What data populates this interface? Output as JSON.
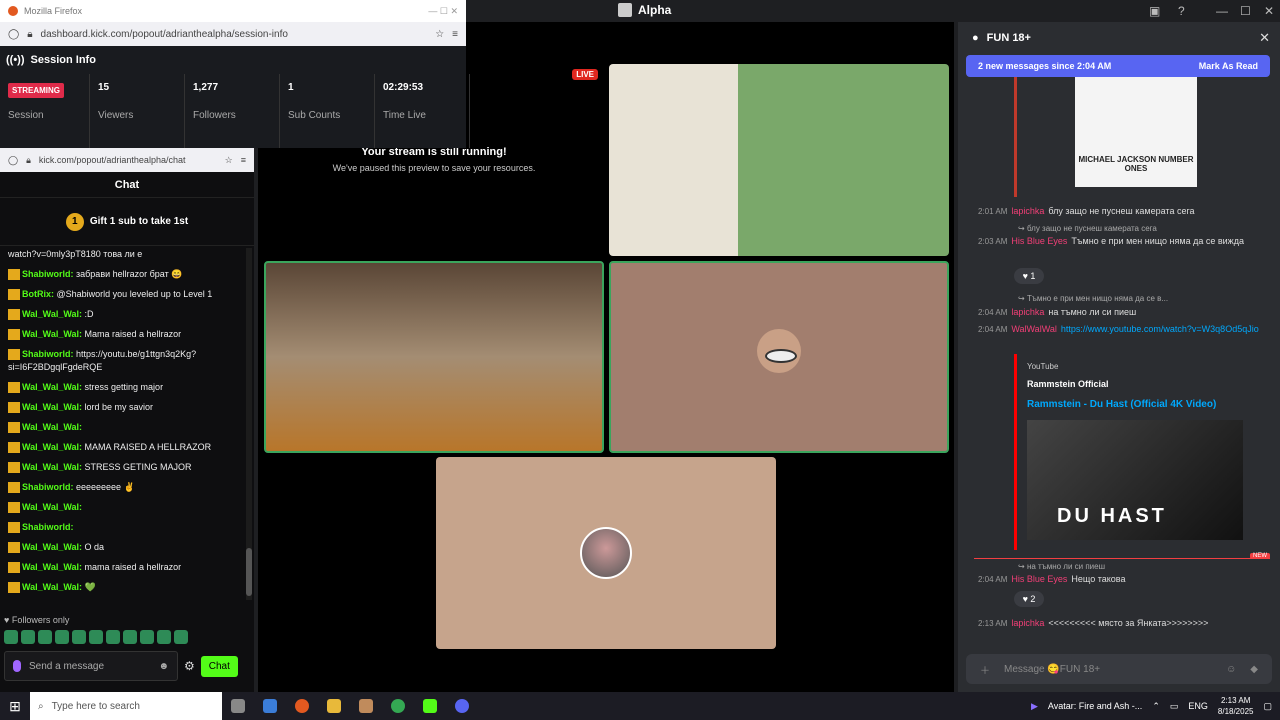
{
  "discord": {
    "window_title": "Alpha",
    "channel": "FUN 18+",
    "new_messages": "2 new messages since 2:04 AM",
    "mark_as_read": "Mark As Read",
    "embed1_text": "MICHAEL JACKSON NUMBER ONES",
    "messages": [
      {
        "time": "2:01 AM",
        "user": "lapichka",
        "text": "блу защо не пуснеш камерата сега"
      },
      {
        "reply": "блу защо не пуснеш камерата сега",
        "time": "2:03 AM",
        "user": "His Blue Eyes",
        "text": "Тъмно е при мен нищо няма да се вижда"
      },
      {
        "reply": "Тъмно е при мен нищо няма да се в...",
        "time": "2:04 AM",
        "user": "lapichka",
        "text": "на тъмно ли си пиеш"
      },
      {
        "time": "2:04 AM",
        "user": "WalWalWal",
        "link": "https://www.youtube.com/watch?v=W3q8Od5qJio"
      },
      {
        "reply": "на тъмно ли си пиеш",
        "time": "2:04 AM",
        "user": "His Blue Eyes",
        "text": "Нещо такова"
      },
      {
        "time": "2:13 AM",
        "user": "lapichka",
        "text": "<<<<<<<<< място за Янката>>>>>>>>"
      }
    ],
    "react1": "1",
    "react2": "2",
    "yt": {
      "source": "YouTube",
      "author": "Rammstein Official",
      "title": "Rammstein - Du Hast (Official 4K Video)",
      "thumb": "DU HAST"
    },
    "new_label": "NEW",
    "input_placeholder": "Message 😋FUN 18+"
  },
  "stage": {
    "live": "LIVE",
    "paused_title": "Your stream is still running!",
    "paused_sub": "We've paused this preview to save your resources."
  },
  "session": {
    "window_title": "Mozilla Firefox",
    "url_domain": "dashboard.kick.com",
    "url_path": "/popout/adrianthealpha/session-info",
    "url_full": "dashboard.kick.com/popout/adrianthealpha/session-info",
    "header": "Session Info",
    "badge": "STREAMING",
    "session_label": "Session",
    "stats": [
      {
        "value": "15",
        "label": "Viewers"
      },
      {
        "value": "1,277",
        "label": "Followers"
      },
      {
        "value": "1",
        "label": "Sub Counts"
      },
      {
        "value": "02:29:53",
        "label": "Time Live"
      }
    ]
  },
  "chat": {
    "url": "kick.com/popout/adrianthealpha/chat",
    "title": "Chat",
    "gift_num": "1",
    "gift_text": "Gift 1 sub to take 1st",
    "messages": [
      {
        "user": "",
        "text": "watch?v=0mly3pT8180 това ли е"
      },
      {
        "user": "Shabiworld:",
        "text": "забрави hellrazor брат 😄"
      },
      {
        "user": "BotRix:",
        "text": "@Shabiworld you leveled up to Level 1"
      },
      {
        "user": "Wal_Wal_Wal:",
        "text": ":D"
      },
      {
        "user": "Wal_Wal_Wal:",
        "text": "Mama raised a hellrazor"
      },
      {
        "user": "Shabiworld:",
        "text": "https://youtu.be/g1ttgn3q2Kg?si=I6F2BDgqlFgdeRQE"
      },
      {
        "user": "Wal_Wal_Wal:",
        "text": "stress getting major"
      },
      {
        "user": "Wal_Wal_Wal:",
        "text": "lord be my savior"
      },
      {
        "user": "Wal_Wal_Wal:",
        "text": ""
      },
      {
        "user": "Wal_Wal_Wal:",
        "text": "MAMA RAISED A HELLRAZOR"
      },
      {
        "user": "Wal_Wal_Wal:",
        "text": "STRESS GETING MAJOR"
      },
      {
        "user": "Shabiworld:",
        "text": "eeeeeeeee ✌"
      },
      {
        "user": "Wal_Wal_Wal:",
        "text": ""
      },
      {
        "user": "Shabiworld:",
        "text": ""
      },
      {
        "user": "Wal_Wal_Wal:",
        "text": "O da"
      },
      {
        "user": "Wal_Wal_Wal:",
        "text": "mama raised a hellrazor"
      },
      {
        "user": "Wal_Wal_Wal:",
        "text": "💚"
      }
    ],
    "followers_only": "Followers only",
    "input_placeholder": "Send a message",
    "send": "Chat"
  },
  "taskbar": {
    "search": "Type here to search",
    "now_playing": "Avatar: Fire and Ash -...",
    "lang": "ENG",
    "time": "2:13 AM",
    "date": "8/18/2025"
  }
}
